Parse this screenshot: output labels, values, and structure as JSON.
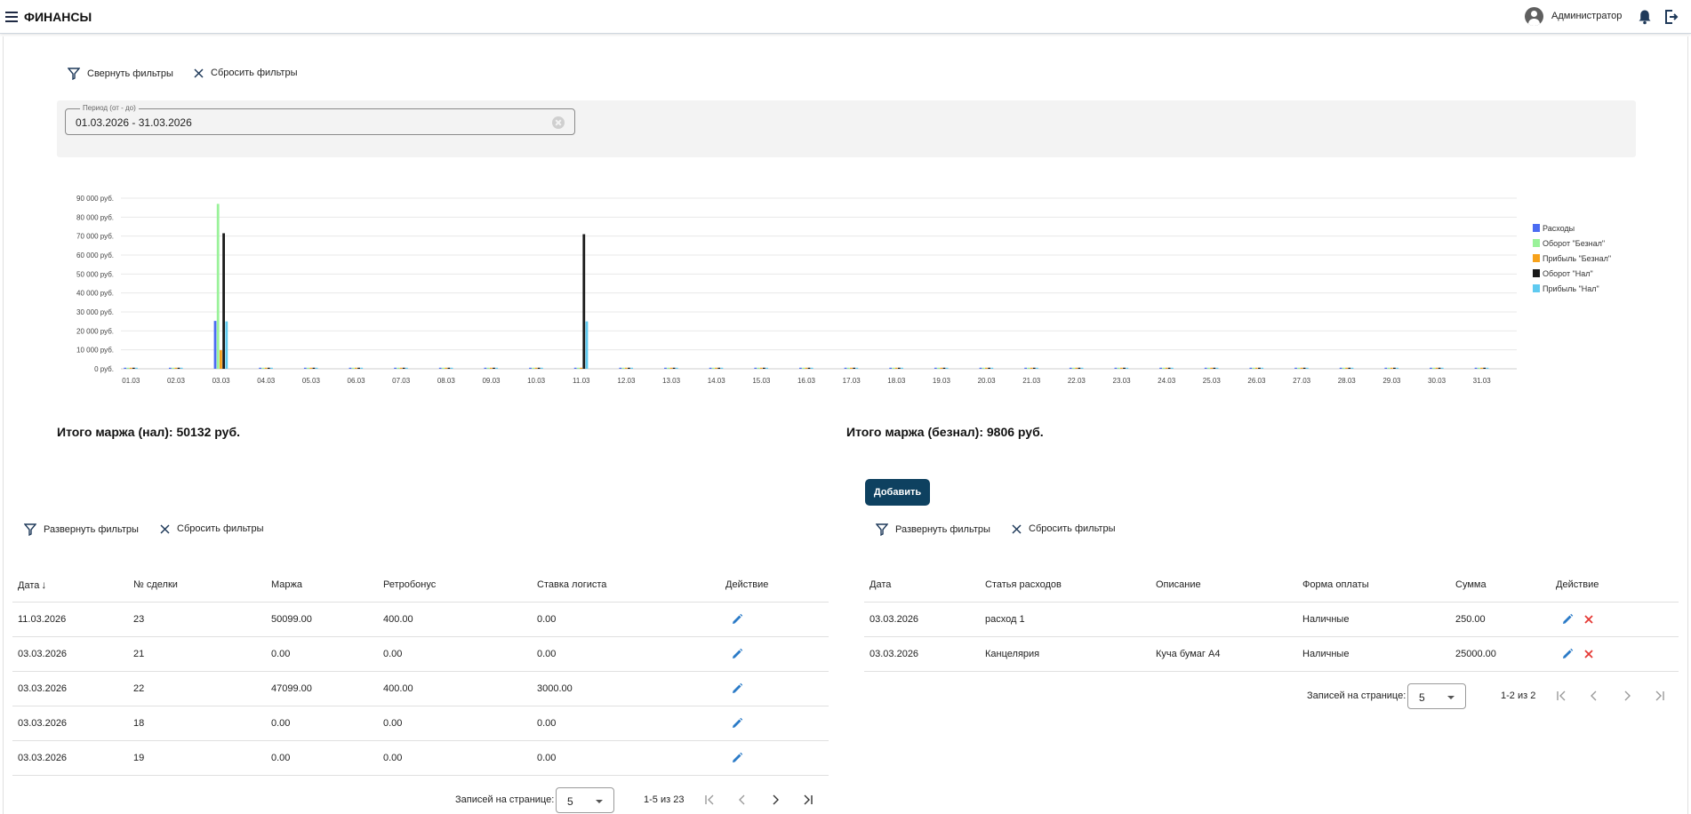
{
  "header": {
    "title": "ФИНАНСЫ",
    "user_name": "Администратор"
  },
  "filters_top": {
    "collapse_label": "Свернуть фильтры",
    "reset_label": "Сбросить фильтры",
    "period_label": "Период (от - до)",
    "period_value": "01.03.2026 - 31.03.2026"
  },
  "colors": {
    "expenses": "#4b6cf2",
    "turnover_card": "#9af29a",
    "profit_card": "#f7a21b",
    "turnover_cash": "#1a1a1a",
    "profit_cash": "#5fcaf0",
    "accent": "#0e4160",
    "edit_icon": "#2b7bc7",
    "delete_icon": "#e53935"
  },
  "chart_data": {
    "type": "bar",
    "categories": [
      "01.03",
      "02.03",
      "03.03",
      "04.03",
      "05.03",
      "06.03",
      "07.03",
      "08.03",
      "09.03",
      "10.03",
      "11.03",
      "12.03",
      "13.03",
      "14.03",
      "15.03",
      "16.03",
      "17.03",
      "18.03",
      "19.03",
      "20.03",
      "21.03",
      "22.03",
      "23.03",
      "24.03",
      "25.03",
      "26.03",
      "27.03",
      "28.03",
      "29.03",
      "30.03",
      "31.03"
    ],
    "series": [
      {
        "name": "Расходы",
        "color": "#4b6cf2",
        "values": [
          0,
          0,
          25250,
          0,
          0,
          0,
          0,
          0,
          0,
          0,
          0,
          0,
          0,
          0,
          0,
          0,
          0,
          0,
          0,
          0,
          0,
          0,
          0,
          0,
          0,
          0,
          0,
          0,
          0,
          0,
          0
        ]
      },
      {
        "name": "Оборот \"Безнал\"",
        "color": "#9af29a",
        "values": [
          0,
          0,
          87000,
          0,
          0,
          0,
          0,
          0,
          0,
          0,
          0,
          0,
          0,
          0,
          0,
          0,
          0,
          0,
          0,
          0,
          0,
          0,
          0,
          0,
          0,
          0,
          0,
          0,
          0,
          0,
          0
        ]
      },
      {
        "name": "Прибыль \"Безнал\"",
        "color": "#f7a21b",
        "values": [
          0,
          0,
          9806,
          0,
          0,
          0,
          0,
          0,
          0,
          0,
          0,
          0,
          0,
          0,
          0,
          0,
          0,
          0,
          0,
          0,
          0,
          0,
          0,
          0,
          0,
          0,
          0,
          0,
          0,
          0,
          0
        ]
      },
      {
        "name": "Оборот \"Нал\"",
        "color": "#1a1a1a",
        "values": [
          0,
          0,
          71500,
          0,
          0,
          0,
          0,
          0,
          0,
          0,
          71000,
          0,
          0,
          0,
          0,
          0,
          0,
          0,
          0,
          0,
          0,
          0,
          0,
          0,
          0,
          0,
          0,
          0,
          0,
          0,
          0
        ]
      },
      {
        "name": "Прибыль \"Нал\"",
        "color": "#5fcaf0",
        "values": [
          0,
          0,
          25000,
          0,
          0,
          0,
          0,
          0,
          0,
          0,
          25000,
          0,
          0,
          0,
          0,
          0,
          0,
          0,
          0,
          0,
          0,
          0,
          0,
          0,
          0,
          0,
          0,
          0,
          0,
          0,
          0
        ]
      }
    ],
    "y_ticks": [
      "0 руб.",
      "10 000 руб.",
      "20 000 руб.",
      "30 000 руб.",
      "40 000 руб.",
      "50 000 руб.",
      "60 000 руб.",
      "70 000 руб.",
      "80 000 руб.",
      "90 000 руб."
    ],
    "ylim": [
      0,
      90000
    ],
    "grid": true,
    "legend": "right"
  },
  "totals": {
    "cash_margin": "Итого маржа (нал): 50132 руб.",
    "card_margin": "Итого маржа (безнал): 9806 руб."
  },
  "deals": {
    "expand_label": "Развернуть фильтры",
    "reset_label": "Сбросить фильтры",
    "columns": [
      "Дата",
      "№ сделки",
      "Маржа",
      "Ретробонус",
      "Ставка логиста",
      "Действие"
    ],
    "rows": [
      [
        "11.03.2026",
        "23",
        "50099.00",
        "400.00",
        "0.00"
      ],
      [
        "03.03.2026",
        "21",
        "0.00",
        "0.00",
        "0.00"
      ],
      [
        "03.03.2026",
        "22",
        "47099.00",
        "400.00",
        "3000.00"
      ],
      [
        "03.03.2026",
        "18",
        "0.00",
        "0.00",
        "0.00"
      ],
      [
        "03.03.2026",
        "19",
        "0.00",
        "0.00",
        "0.00"
      ]
    ],
    "pager": {
      "label": "Записей на странице:",
      "page_size": "5",
      "range": "1-5 из 23"
    }
  },
  "expenses": {
    "add_label": "Добавить",
    "expand_label": "Развернуть фильтры",
    "reset_label": "Сбросить фильтры",
    "columns": [
      "Дата",
      "Статья расходов",
      "Описание",
      "Форма оплаты",
      "Сумма",
      "Действие"
    ],
    "rows": [
      [
        "03.03.2026",
        "расход 1",
        "",
        "Наличные",
        "250.00"
      ],
      [
        "03.03.2026",
        "Канцелярия",
        "Куча бумаг А4",
        "Наличные",
        "25000.00"
      ]
    ],
    "pager": {
      "label": "Записей на странице:",
      "page_size": "5",
      "range": "1-2 из 2"
    }
  }
}
